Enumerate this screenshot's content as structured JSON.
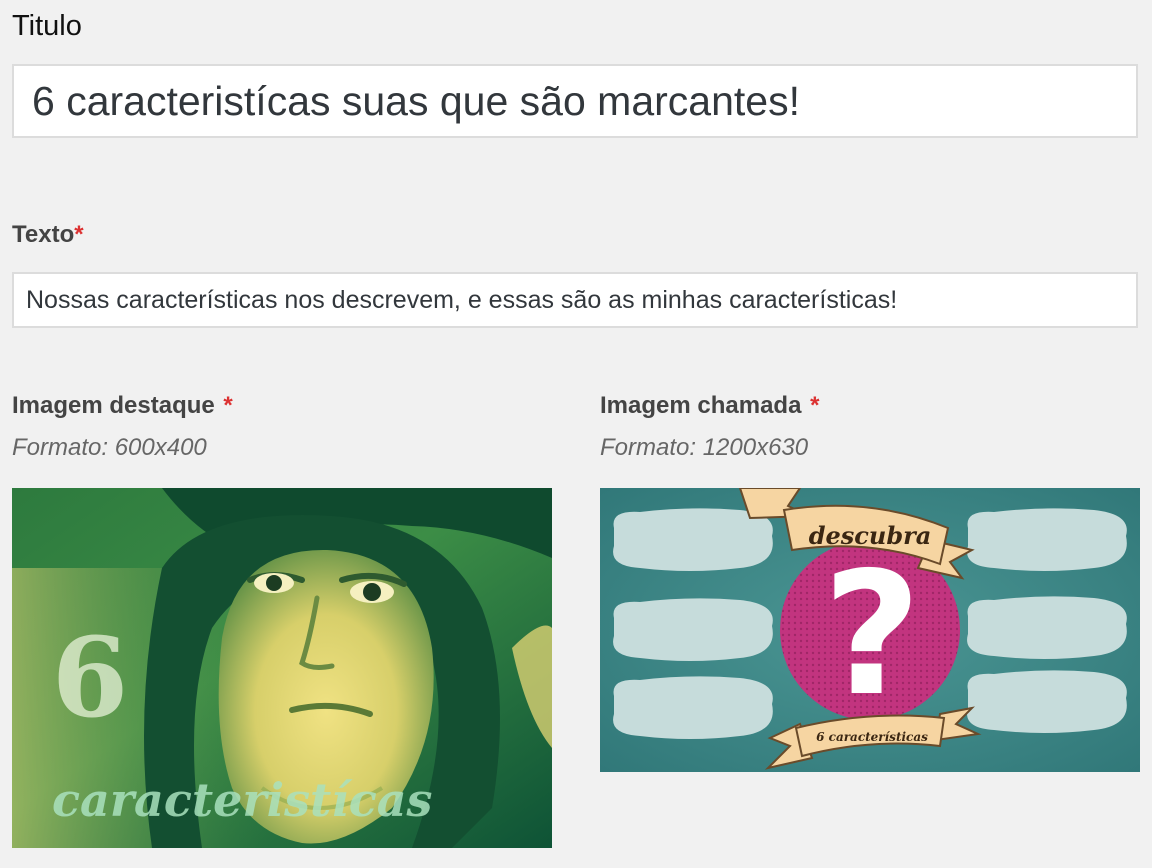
{
  "titulo": {
    "label": "Titulo",
    "value": "6 caracteristícas suas que são marcantes!"
  },
  "texto": {
    "label": "Texto",
    "required_mark": "*",
    "value": "Nossas características nos descrevem, e essas são as minhas características!"
  },
  "imagem_destaque": {
    "label": "Imagem destaque",
    "required_mark": "*",
    "format": "Formato: 600x400",
    "overlay_number": "6",
    "overlay_text": "caracteristícas"
  },
  "imagem_chamada": {
    "label": "Imagem chamada",
    "required_mark": "*",
    "format": "Formato: 1200x630",
    "banner_top": "descubra",
    "banner_bottom": "6 características",
    "center_symbol": "?"
  },
  "colors": {
    "required": "#dc3232",
    "destaque_green": "#1f5e3a",
    "destaque_yellow": "#e8dc7a",
    "chamada_teal": "#3f8a88",
    "chamada_pink": "#c2347f",
    "ribbon": "#f6d5a2"
  }
}
